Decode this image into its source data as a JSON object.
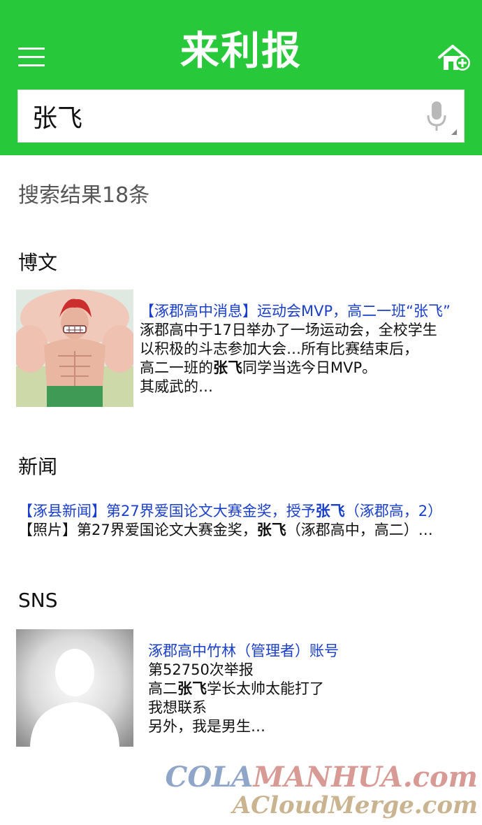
{
  "header": {
    "title": "来利报",
    "menu_icon": "hamburger-menu-icon",
    "add_home_icon": "add-home-icon",
    "bg_color": "#27c93a"
  },
  "search": {
    "value": "张飞",
    "mic_icon": "microphone-icon"
  },
  "result_count": "搜索结果18条",
  "sections": {
    "blog": {
      "title": "博文",
      "item": {
        "headline": "【涿郡高中消息】运动会MVP，高二一班“张飞”",
        "line1": "涿郡高中于17日举办了一场运动会，全校学生",
        "line2": "以积极的斗志参加大会…所有比赛结束后，",
        "line3_pre": "高二一班的",
        "line3_bold": "张飞",
        "line3_post": "同学当选今日MVP。",
        "line4": "其威武的…"
      }
    },
    "news": {
      "title": "新闻",
      "line1_pre": "【涿县新闻】第27界爱国论文大赛金奖，授予",
      "line1_bold": "张飞",
      "line1_post": "（涿郡高，2）",
      "line2_pre": "【照片】第27界爱国论文大赛金奖，",
      "line2_bold": "张飞",
      "line2_post": "（涿郡高中，高二）…"
    },
    "sns": {
      "title": "SNS",
      "item": {
        "account": "涿郡高中竹林（管理者）账号",
        "line1": "第52750次举报",
        "line2_pre": "高二",
        "line2_bold": "张飞",
        "line2_post": "学长太帅太能打了",
        "line3": "我想联系",
        "line4": "另外，我是男生…"
      }
    }
  },
  "watermark": {
    "line1_cola": "COLA",
    "line1_manhua": "MANHUA",
    "line1_com": ".com",
    "line2": "ACloudMerge.com"
  },
  "colors": {
    "link_blue": "#1a3fc9",
    "watermark_blue": "#8fa6c9",
    "watermark_red": "#d89a95",
    "watermark_tan": "#c9b48f"
  }
}
